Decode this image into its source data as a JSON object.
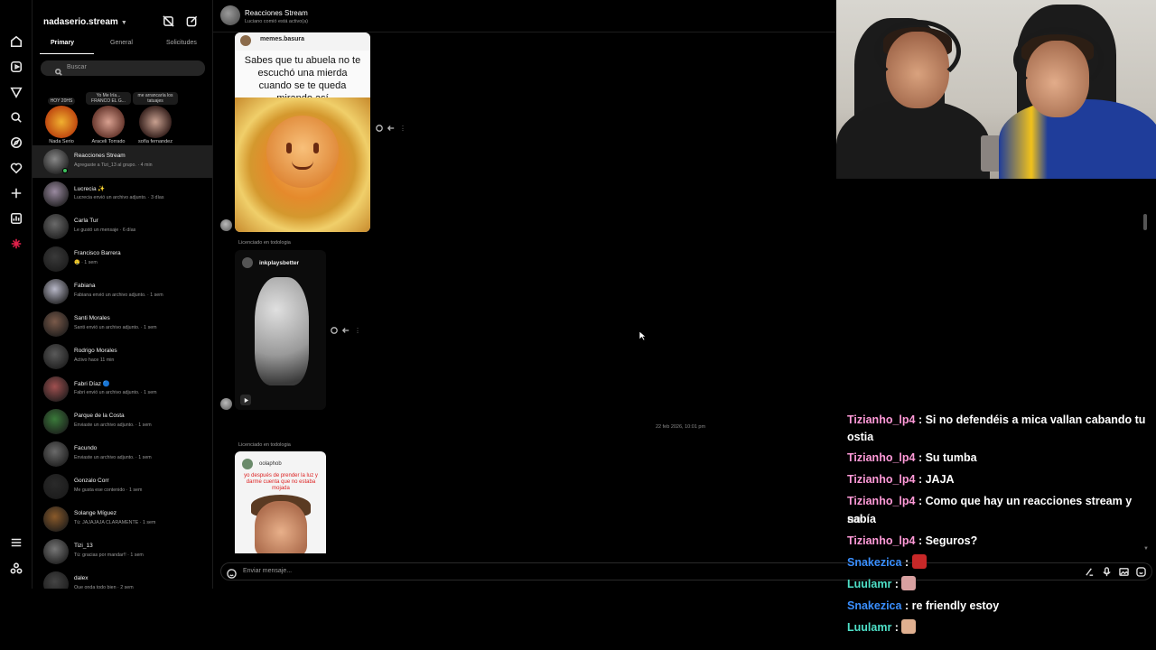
{
  "account": {
    "name": "nadaserio.stream"
  },
  "tabs": [
    {
      "label": "Primary",
      "active": true
    },
    {
      "label": "General",
      "active": false
    },
    {
      "label": "Solicitudes",
      "active": false
    }
  ],
  "search": {
    "placeholder": "Buscar"
  },
  "notes": [
    {
      "bubble": "HOY 20HS",
      "name": "Nada Serio"
    },
    {
      "bubble": "Yo Me Iría... FRANCO EL G...",
      "name": "Araceli Torrado"
    },
    {
      "bubble": "me arrancaría los tatuajes",
      "name": "sofía fernandez"
    }
  ],
  "threads": [
    {
      "name": "Reacciones Stream",
      "preview": "Agregaste a Tizi_13 al grupo. · 4 min",
      "selected": true,
      "online": true
    },
    {
      "name": "Lucrecia ✨",
      "preview": "Lucrecia envió un archivo adjunto. · 3 días"
    },
    {
      "name": "Carla Tur",
      "preview": "Le gustó un mensaje · 6 días"
    },
    {
      "name": "Francisco Barrera",
      "preview": "🤤 · 1 sem"
    },
    {
      "name": "Fabiana",
      "preview": "Fabiana envió un archivo adjunto. · 1 sem"
    },
    {
      "name": "Santi Morales",
      "preview": "Santi envió un archivo adjunto. · 1 sem"
    },
    {
      "name": "Rodrigo Morales",
      "preview": "Activo hace 11 min"
    },
    {
      "name": "Fabri Díaz 🔵",
      "preview": "Fabri envió un archivo adjunto. · 1 sem"
    },
    {
      "name": "Parque de la Costa",
      "preview": "Enviaste un archivo adjunto. · 1 sem"
    },
    {
      "name": "Facundo",
      "preview": "Enviaste un archivo adjunto. · 1 sem"
    },
    {
      "name": "Gonzalo Corr",
      "preview": "Me gusta ese contenido · 1 sem"
    },
    {
      "name": "Solange Míguez",
      "preview": "Tú: JAJAJAJA CLARAMENTE · 1 sem"
    },
    {
      "name": "Tizi_13",
      "preview": "Tú: gracias por mandar!! · 1 sem"
    },
    {
      "name": "dalex",
      "preview": "Que onda todo bien · 2 sem"
    }
  ],
  "chat": {
    "title": "Reacciones Stream",
    "subtitle": "Luciano comió está activo(a)",
    "card1": {
      "handle": "memes.basura",
      "text": "Sabes que tu abuela no te escuchó una mierda cuando se te queda mirando así"
    },
    "label2": "Licenciado en todologia",
    "card2": {
      "handle": "inkplaysbetter"
    },
    "date": "22 feb 2026, 10:01 pm",
    "label3": "Licenciado en todologia",
    "card3": {
      "handle": "oolaphob",
      "overlay": "yo después de prender la luz y darme cuenta que no estaba mojada"
    },
    "composer_placeholder": "Enviar mensaje..."
  },
  "stream_chat": [
    {
      "user": "Tizianho_lp4",
      "color": "pink",
      "text": "Si no defendéis a mica vallan cabando tu"
    },
    {
      "user": "",
      "color": "pink",
      "text": "ostia"
    },
    {
      "user": "Tizianho_lp4",
      "color": "pink",
      "text": "Su tumba"
    },
    {
      "user": "Tizianho_lp4",
      "color": "pink",
      "text": "JAJA"
    },
    {
      "user": "Tizianho_lp4",
      "color": "pink",
      "text": "Como que hay un reacciones stream y no"
    },
    {
      "user": "",
      "color": "pink",
      "text": "sabía"
    },
    {
      "user": "Tizianho_lp4",
      "color": "pink",
      "text": "Seguros?"
    },
    {
      "user": "Snakezica",
      "color": "blue",
      "text": "",
      "emote": "#c82828"
    },
    {
      "user": "Luulamr",
      "color": "teal",
      "text": "",
      "emote": "#d8a0a0"
    },
    {
      "user": "Snakezica",
      "color": "blue",
      "text": "re friendly estoy"
    },
    {
      "user": "Luulamr",
      "color": "teal",
      "text": "",
      "emote": "#e0b090"
    }
  ],
  "colors": {
    "background": "#000000",
    "selected_row": "#1f1f1f",
    "online_dot": "#3ec35e",
    "chat_user_pink": "#ff9ad8",
    "chat_user_blue": "#3a8fff",
    "chat_user_teal": "#4fe0c8"
  }
}
